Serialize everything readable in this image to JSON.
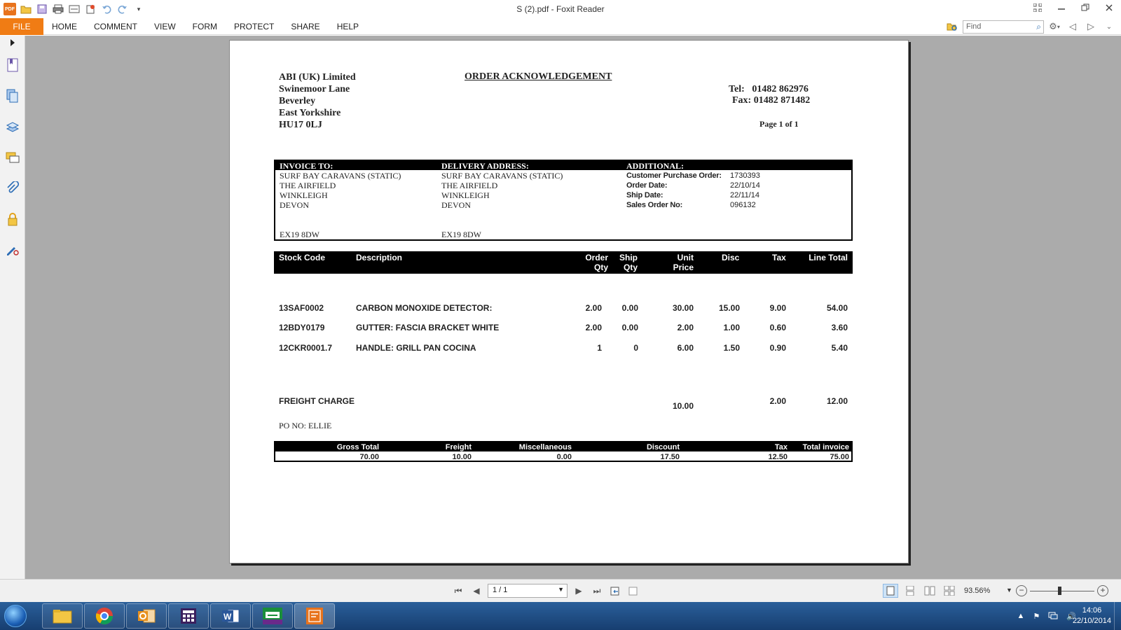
{
  "window": {
    "title": "S (2).pdf - Foxit Reader"
  },
  "app": {
    "logo_text": "PDF"
  },
  "menu": {
    "tabs": [
      "FILE",
      "HOME",
      "COMMENT",
      "VIEW",
      "FORM",
      "PROTECT",
      "SHARE",
      "HELP"
    ],
    "find_placeholder": "Find"
  },
  "document": {
    "company": {
      "name": "ABI (UK) Limited",
      "address": [
        "Swinemoor Lane",
        "Beverley",
        "East Yorkshire",
        "HU17 0LJ"
      ]
    },
    "title": "ORDER ACKNOWLEDGEMENT",
    "tel_label": "Tel:",
    "tel": "01482 862976",
    "fax_label": "Fax:",
    "fax": "01482 871482",
    "page_of": "Page 1 of 1",
    "invoice_to": {
      "header": "INVOICE TO:",
      "lines": [
        "SURF BAY CARAVANS (STATIC)",
        "THE AIRFIELD",
        "WINKLEIGH",
        "DEVON"
      ],
      "postcode": "EX19 8DW"
    },
    "delivery": {
      "header": "DELIVERY ADDRESS:",
      "lines": [
        "SURF BAY CARAVANS (STATIC)",
        "THE AIRFIELD",
        "WINKLEIGH",
        "DEVON"
      ],
      "postcode": "EX19 8DW"
    },
    "additional": {
      "header": "ADDITIONAL:",
      "fields": [
        {
          "label": "Customer Purchase Order:",
          "value": "1730393"
        },
        {
          "label": "Order Date:",
          "value": "22/10/14"
        },
        {
          "label": "Ship Date:",
          "value": "22/11/14"
        },
        {
          "label": "Sales Order No:",
          "value": "096132"
        }
      ]
    },
    "items_header": {
      "stock_code": "Stock Code",
      "description": "Description",
      "order_qty_1": "Order",
      "order_qty_2": "Qty",
      "ship_qty_1": "Ship",
      "ship_qty_2": "Qty",
      "unit_price_1": "Unit",
      "unit_price_2": "Price",
      "disc": "Disc",
      "tax": "Tax",
      "line_total": "Line Total"
    },
    "items": [
      {
        "code": "13SAF0002",
        "desc": "CARBON MONOXIDE DETECTOR:",
        "order_qty": "2.00",
        "ship_qty": "0.00",
        "unit_price": "30.00",
        "disc": "15.00",
        "tax": "9.00",
        "total": "54.00"
      },
      {
        "code": "12BDY0179",
        "desc": "GUTTER: FASCIA BRACKET WHITE",
        "order_qty": "2.00",
        "ship_qty": "0.00",
        "unit_price": "2.00",
        "disc": "1.00",
        "tax": "0.60",
        "total": "3.60"
      },
      {
        "code": "12CKR0001.7",
        "desc": "HANDLE: GRILL PAN COCINA",
        "order_qty": "1",
        "ship_qty": "0",
        "unit_price": "6.00",
        "disc": "1.50",
        "tax": "0.90",
        "total": "5.40"
      }
    ],
    "freight": {
      "label": "FREIGHT CHARGE",
      "price": "10.00",
      "tax": "2.00",
      "total": "12.00"
    },
    "po_no": "PO NO: ELLIE",
    "totals": {
      "labels": [
        "Gross Total",
        "Freight",
        "Miscellaneous",
        "Discount",
        "Tax",
        "Total invoice"
      ],
      "values": [
        "70.00",
        "10.00",
        "0.00",
        "17.50",
        "12.50",
        "75.00"
      ]
    }
  },
  "statusbar": {
    "page_indicator": "1 / 1",
    "zoom": "93.56%"
  },
  "taskbar": {
    "time": "14:06",
    "date": "22/10/2014"
  }
}
